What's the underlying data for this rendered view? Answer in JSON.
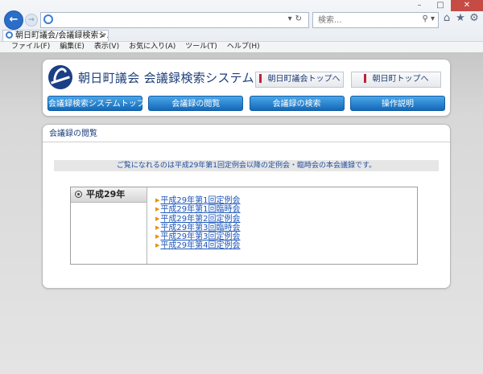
{
  "browser": {
    "search_placeholder": "検索...",
    "tab_title": "朝日町議会/会議録検索シ...",
    "menu": [
      "ファイル(F)",
      "編集(E)",
      "表示(V)",
      "お気に入り(A)",
      "ツール(T)",
      "ヘルプ(H)"
    ]
  },
  "site": {
    "title": "朝日町議会 会議録検索システム",
    "top_links": {
      "gikai": "朝日町議会トップへ",
      "town": "朝日町トップへ"
    },
    "nav": [
      "会議録検索システムトップ",
      "会議録の閲覧",
      "会議録の検索",
      "操作説明"
    ]
  },
  "main": {
    "section_title": "会議録の閲覧",
    "notice": "ご覧になれるのは平成29年第1回定例会以降の定例会・臨時会の本会議録です。",
    "year_label": "平成29年",
    "sessions": [
      "平成29年第1回定例会",
      "平成29年第1回臨時会",
      "平成29年第2回定例会",
      "平成29年第3回臨時会",
      "平成29年第3回定例会",
      "平成29年第4回定例会"
    ]
  }
}
